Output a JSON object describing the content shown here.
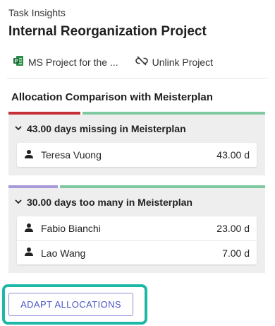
{
  "header": {
    "subtitle": "Task Insights",
    "title": "Internal Reorganization Project"
  },
  "links": {
    "project_link": {
      "label": "MS Project for the ...",
      "icon": "ms-project-icon"
    },
    "unlink": {
      "label": "Unlink Project",
      "icon": "unlink-icon"
    }
  },
  "comparison": {
    "title": "Allocation Comparison with Meisterplan",
    "groups": [
      {
        "label": "43.00 days missing in Meisterplan",
        "bar": {
          "status": "missing",
          "accent_color": "#c62f3a",
          "base_color": "#7fc8a0"
        },
        "rows": [
          {
            "name": "Teresa Vuong",
            "value": "43.00 d"
          }
        ]
      },
      {
        "label": "30.00 days too many in Meisterplan",
        "bar": {
          "status": "too-many",
          "accent_color": "#a89ad8",
          "base_color": "#7fc8a0"
        },
        "rows": [
          {
            "name": "Fabio Bianchi",
            "value": "23.00 d"
          },
          {
            "name": "Lao Wang",
            "value": "7.00 d"
          }
        ]
      }
    ]
  },
  "actions": {
    "adapt_label": "ADAPT ALLOCATIONS",
    "highlight_color": "#1eb8a6"
  }
}
